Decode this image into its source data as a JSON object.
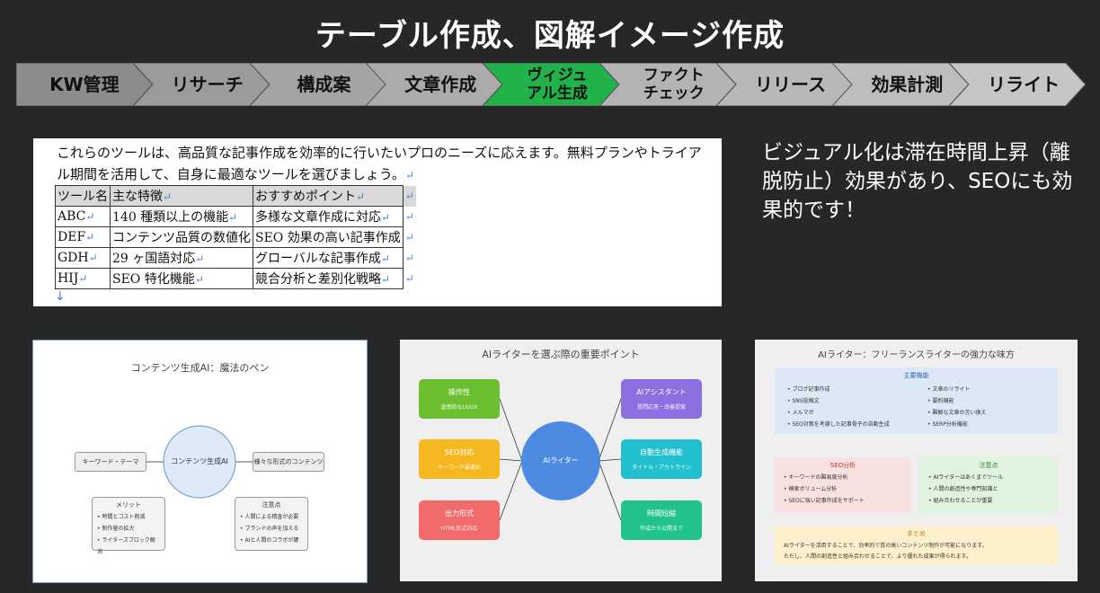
{
  "title": "テーブル作成、図解イメージ作成",
  "steps": [
    {
      "label": "KW管理",
      "color": "#8c8c8c"
    },
    {
      "label": "リサーチ",
      "color": "#9b9b9b"
    },
    {
      "label": "構成案",
      "color": "#a4a4a4"
    },
    {
      "label": "文章作成",
      "color": "#ababab"
    },
    {
      "label": "ヴィジュ\nアル生成",
      "color": "#22b24c"
    },
    {
      "label": "ファクト\nチェック",
      "color": "#b3b3b3"
    },
    {
      "label": "リリース",
      "color": "#b8b8b8"
    },
    {
      "label": "効果計測",
      "color": "#bdbdbd"
    },
    {
      "label": "リライト",
      "color": "#c6c6c6"
    }
  ],
  "doc": {
    "paragraph": "これらのツールは、高品質な記事作成を効率的に行いたいプロのニーズに応えます。無料プランやトライアル期間を活用して、自身に最適なツールを選びましょう。",
    "return_mark": "↵",
    "bottom_mark": "↓",
    "headers": [
      "ツール名",
      "主な特徴",
      "おすすめポイント"
    ],
    "rows": [
      [
        "ABC",
        "140 種類以上の機能",
        "多様な文章作成に対応"
      ],
      [
        "DEF",
        "コンテンツ品質の数値化",
        "SEO 効果の高い記事作成"
      ],
      [
        "GDH",
        "29 ヶ国語対応",
        "グローバルな記事作成"
      ],
      [
        "HIJ",
        "SEO 特化機能",
        "競合分析と差別化戦略"
      ]
    ]
  },
  "side_text": "ビジュアル化は滞在時間上昇（離脱防止）効果があり、SEOにも効果的です！",
  "diagram1": {
    "title": "コンテンツ生成AI：魔法のペン",
    "center": "コンテンツ生成AI",
    "input": "キーワード・テーマ",
    "output": "様々な形式のコンテンツ",
    "merit_title": "メリット",
    "merits": [
      "時間とコスト削減",
      "制作量の拡大",
      "ライターズブロック解消"
    ],
    "caution_title": "注意点",
    "cautions": [
      "人間による精査が必要",
      "ブランドの声を加える",
      "AIと人間のコラボが鍵"
    ]
  },
  "diagram2": {
    "title": "AIライターを選ぶ際の重要ポイント",
    "center": "AIライター",
    "nodes": [
      {
        "title": "操作性",
        "sub": "直感的なUI/UX",
        "color": "#6cbf2f"
      },
      {
        "title": "SEO対応",
        "sub": "キーワード最適化",
        "color": "#f5b820"
      },
      {
        "title": "出力形式",
        "sub": "HTML形式対応",
        "color": "#f26b6b"
      },
      {
        "title": "AIアシスタント",
        "sub": "質問応答・改善提案",
        "color": "#8e6fe0"
      },
      {
        "title": "自動生成機能",
        "sub": "タイトル・アウトライン",
        "color": "#22bfcf"
      },
      {
        "title": "時間短縮",
        "sub": "作成から公開まで",
        "color": "#22c28f"
      }
    ]
  },
  "diagram3": {
    "title": "AIライター：フリーランスライターの強力な味方",
    "main_title": "主要機能",
    "main_left": [
      "ブログ記事作成",
      "SNS投稿文",
      "メルマガ",
      "SEO対策を考慮した記事骨子の自動生成"
    ],
    "main_right": [
      "文章のリライト",
      "要約機能",
      "難解な文章の言い換え",
      "SERP分析機能"
    ],
    "seo_title": "SEO分析",
    "seo_items": [
      "キーワードの難易度分析",
      "検索ボリューム分析",
      "SEOに強い記事作成をサポート"
    ],
    "note_title": "注意点",
    "note_items": [
      "AIライターはあくまでツール",
      "人間の創造性や専門知識と",
      "組み合わせることが重要"
    ],
    "summary_title": "まとめ",
    "summary_lines": [
      "AIライターを活用することで、効率的で質の高いコンテンツ制作が可能になります。",
      "ただし、人間の創造性と組み合わせることで、より優れた成果が得られます。"
    ]
  }
}
